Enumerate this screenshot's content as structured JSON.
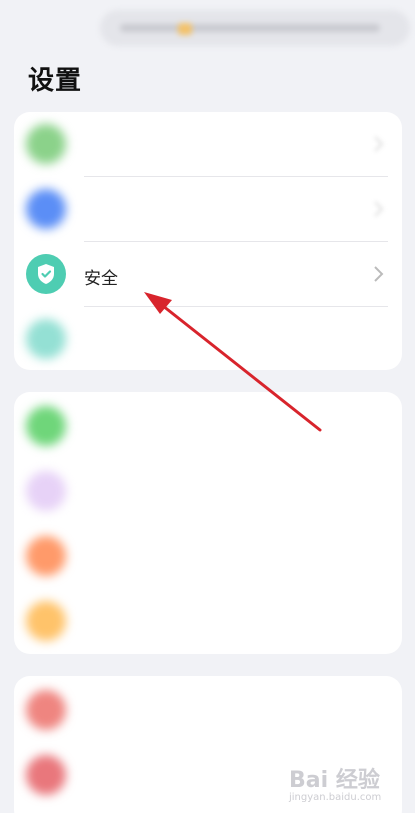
{
  "page_title": "设置",
  "groups": [
    {
      "items": [
        {
          "label": "",
          "icon": "green-circle-icon",
          "color": "#8bd28a",
          "blurred": true
        },
        {
          "label": "",
          "icon": "blue-circle-icon",
          "color": "#5b8ef6",
          "blurred": true
        },
        {
          "label": "安全",
          "icon": "shield-icon",
          "color": "#4ecdb2",
          "blurred": false
        },
        {
          "label": "",
          "icon": "teal-circle-icon",
          "color": "#94e0d4",
          "blurred": true
        }
      ]
    },
    {
      "items": [
        {
          "label": "",
          "icon": "green-circle-icon",
          "color": "#6fd67a",
          "blurred": true
        },
        {
          "label": "",
          "icon": "lavender-circle-icon",
          "color": "#e7d2f7",
          "blurred": true
        },
        {
          "label": "",
          "icon": "orange-circle-icon",
          "color": "#ff9a6a",
          "blurred": true
        },
        {
          "label": "",
          "icon": "yellow-circle-icon",
          "color": "#ffc36a",
          "blurred": true
        }
      ]
    },
    {
      "items": [
        {
          "label": "",
          "icon": "red-circle-icon",
          "color": "#ef8580",
          "blurred": true
        },
        {
          "label": "",
          "icon": "red-circle-icon",
          "color": "#e9777c",
          "blurred": true
        }
      ]
    }
  ],
  "annotation": {
    "color": "#d8242c",
    "target": "安全"
  },
  "watermark_text": "Bai 经验",
  "watermark_sub": "jingyan.baidu.com"
}
